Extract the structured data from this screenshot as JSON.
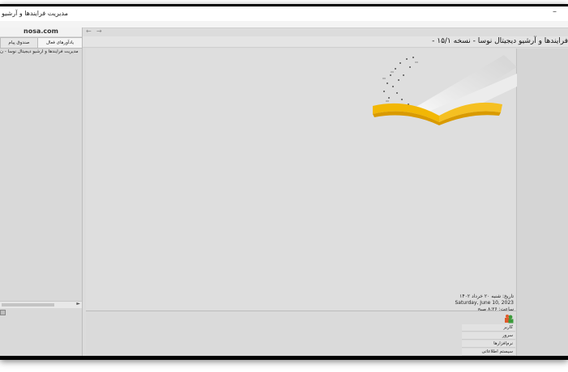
{
  "window": {
    "title": "مدیریت فرایندها و آرشیو"
  },
  "left_panel": {
    "logo_text": "nosa.com",
    "tabs": [
      "یادآورهای فعال",
      "صندوق پیام"
    ],
    "tree_item": "مدیریت فرایندها و آرشیو دیجیتال نوسا - ن"
  },
  "nav": {
    "back_arrow": "←",
    "forward_arrow": "→"
  },
  "header": {
    "title": "فرایندها و آرشیو دیجیتال نوسا - نسخه ۱۵/۱ -"
  },
  "date_info": {
    "date_fa": "تاریخ: شنبه ۲۰ خرداد ۱۴۰۲",
    "date_en": "Saturday, June 10, 2023",
    "time": "ساعت: ۸:۲۶ صبح"
  },
  "menu": {
    "items": [
      "کاربر",
      "سرور",
      "نرم‌افزارها",
      "سیستم اطلاعاتی"
    ]
  },
  "colors": {
    "accent_gold": "#f2b705",
    "panel_gray": "#dcdcdc"
  },
  "icons": {
    "user": "users-icon",
    "min": "minimize-icon"
  }
}
